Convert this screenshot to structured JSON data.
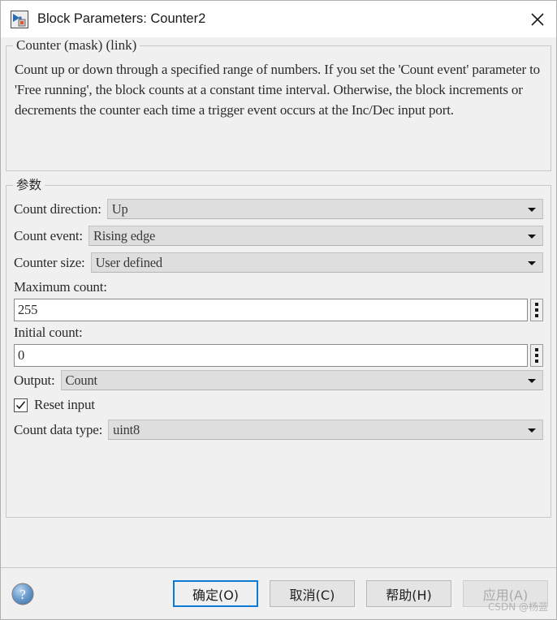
{
  "window": {
    "title": "Block Parameters: Counter2",
    "icon": "simulink-block-icon",
    "close_label": "close-icon"
  },
  "description_group": {
    "legend": "Counter (mask) (link)",
    "text": "Count up or down through a specified range of numbers. If you set the 'Count event' parameter to 'Free running', the block counts at a constant time interval. Otherwise, the block increments or decrements the counter each time a trigger event occurs at the Inc/Dec input port."
  },
  "parameters_group": {
    "legend": "参数",
    "count_direction": {
      "label": "Count direction:",
      "value": "Up"
    },
    "count_event": {
      "label": "Count event:",
      "value": "Rising edge"
    },
    "counter_size": {
      "label": "Counter size:",
      "value": "User defined"
    },
    "maximum_count": {
      "label": "Maximum count:",
      "value": "255"
    },
    "initial_count": {
      "label": "Initial count:",
      "value": "0"
    },
    "output": {
      "label": "Output:",
      "value": "Count"
    },
    "reset_input": {
      "label": "Reset input",
      "checked": true
    },
    "count_data_type": {
      "label": "Count data type:",
      "value": "uint8"
    }
  },
  "footer": {
    "help_icon": "help-question-icon",
    "ok_label": "确定(O)",
    "cancel_label": "取消(C)",
    "help_label": "帮助(H)",
    "apply_label": "应用(A)",
    "watermark": "CSDN @杨蓝"
  },
  "colors": {
    "dialog_bg": "#f0f0f0",
    "titlebar_bg": "#ffffff",
    "combo_bg": "#dedede",
    "field_bg": "#ffffff",
    "focus_blue": "#0b7ad5"
  }
}
